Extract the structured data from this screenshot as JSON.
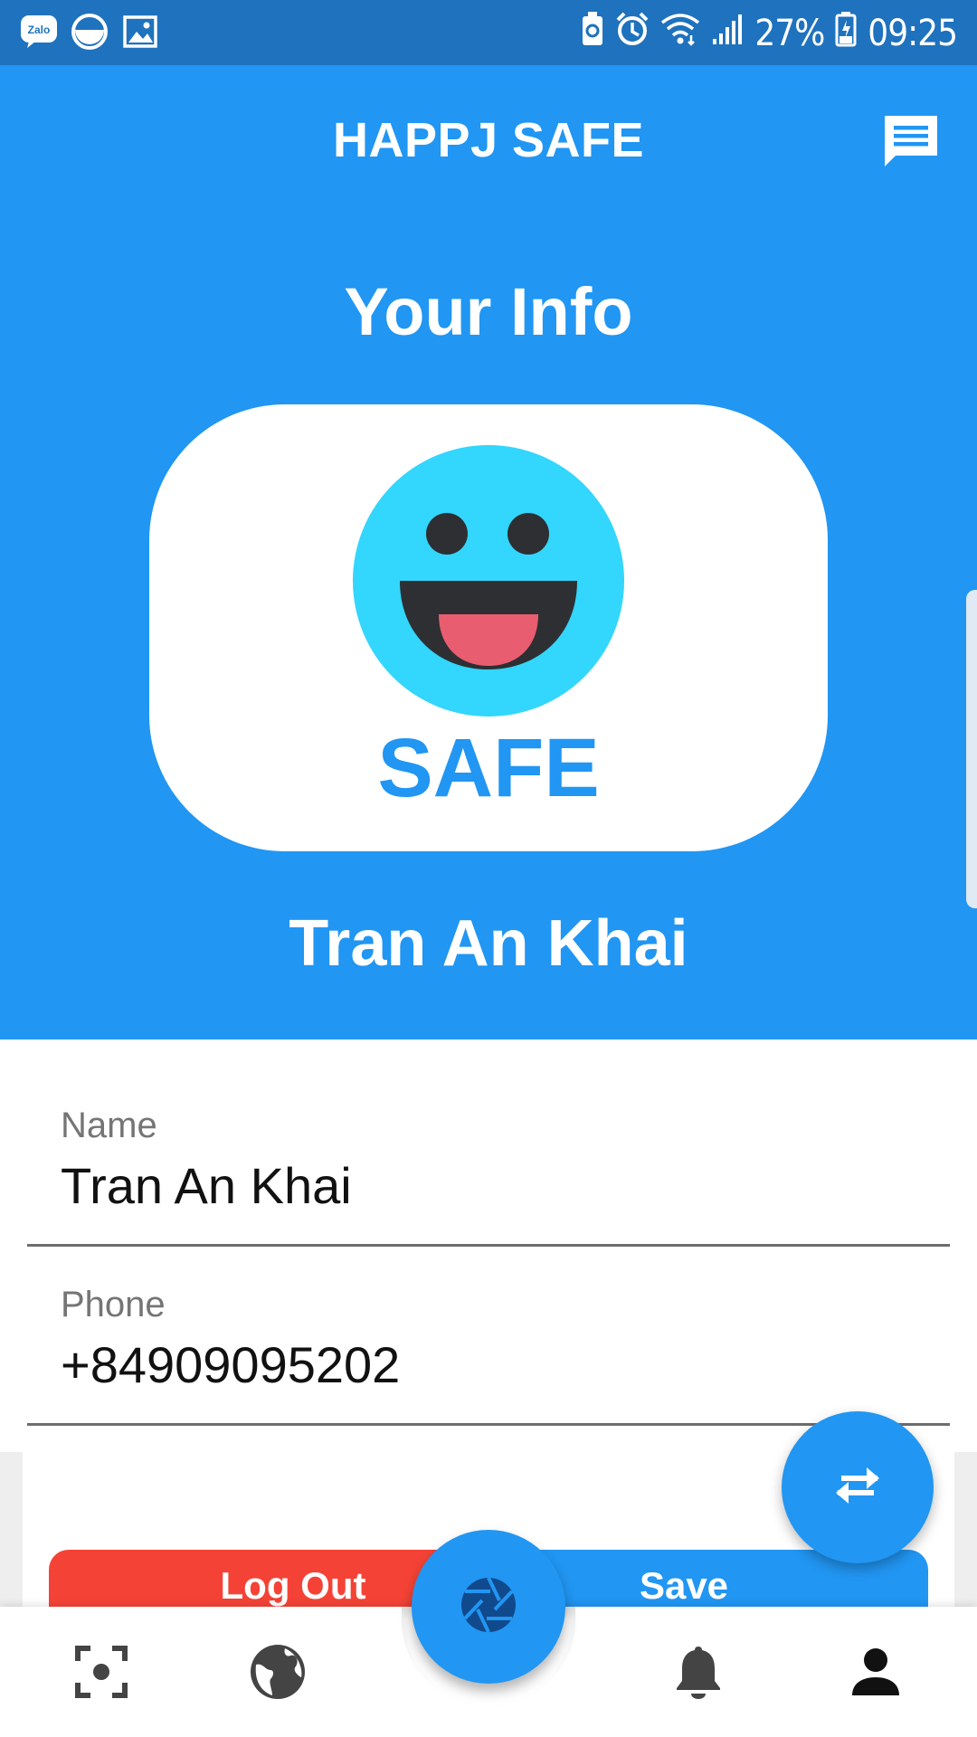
{
  "status_bar": {
    "battery_percent": "27%",
    "time": "09:25",
    "left_icons": [
      "zalo-icon",
      "clean-icon",
      "image-icon"
    ],
    "right_icons": [
      "battery-saver-icon",
      "alarm-icon",
      "wifi-icon",
      "signal-icon",
      "battery-icon"
    ]
  },
  "header": {
    "title": "HAPPJ SAFE",
    "section_title": "Your Info",
    "logo_text": "SAFE",
    "profile_name": "Tran An Khai"
  },
  "form": {
    "name_label": "Name",
    "name_value": "Tran An Khai",
    "phone_label": "Phone",
    "phone_value": "+84909095202"
  },
  "actions": {
    "logout_label": "Log Out",
    "save_label": "Save"
  },
  "bottom_nav": {
    "items": [
      "scan-icon",
      "globe-icon",
      "camera-shutter-icon",
      "bell-icon",
      "person-icon"
    ]
  },
  "colors": {
    "primary": "#2196f3",
    "status_bar": "#1f72bd",
    "danger": "#f44336",
    "smiley_face": "#33d6fc",
    "smiley_tongue": "#e95d70"
  }
}
